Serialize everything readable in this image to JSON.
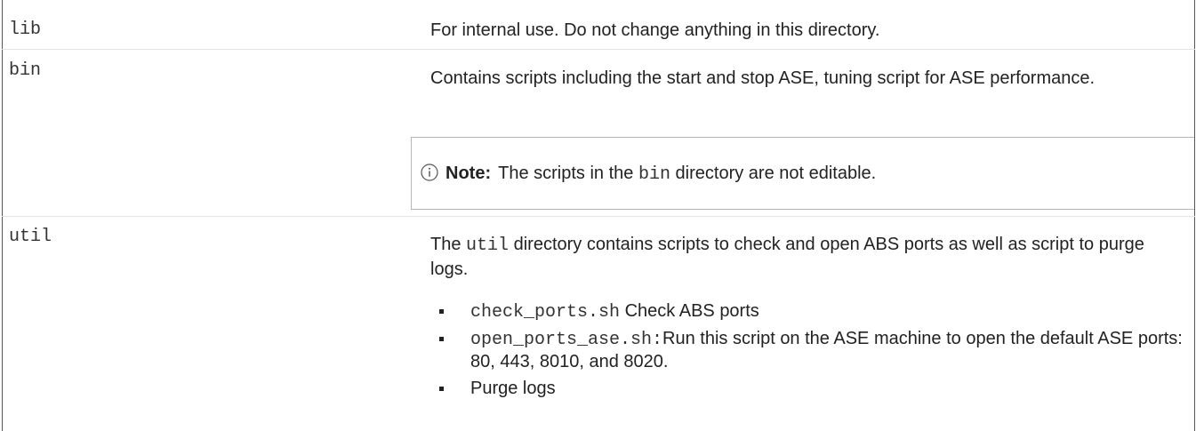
{
  "rows": [
    {
      "name": "lib",
      "description": "For internal use. Do not change anything in this directory."
    },
    {
      "name": "bin",
      "description": "Contains scripts including the start and stop ASE, tuning script for ASE performance.",
      "note": {
        "icon": "info-circle-icon",
        "label": "Note:",
        "text_before": "The scripts in the",
        "code": "bin",
        "text_after": "directory are not editable."
      }
    },
    {
      "name": "util",
      "description_before": "The",
      "description_code": "util",
      "description_after": "directory contains scripts to check and open ABS ports as well as script to purge logs.",
      "items": [
        {
          "code": "check_ports.sh",
          "text": "Check ABS ports"
        },
        {
          "code": "open_ports_ase.sh:",
          "text": "Run this script on the ASE machine to open the default ASE ports: 80, 443, 8010, and 8020."
        },
        {
          "code": "",
          "text": "Purge logs"
        }
      ]
    }
  ]
}
